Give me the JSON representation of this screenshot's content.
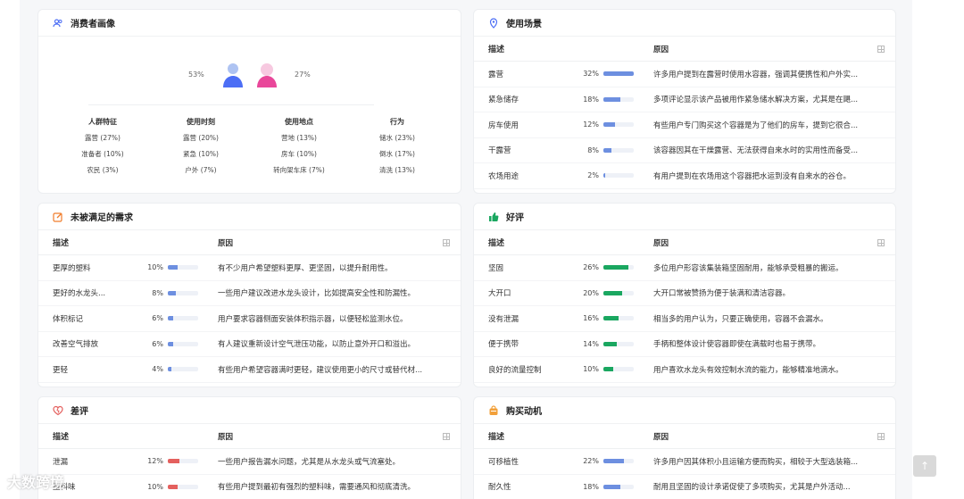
{
  "persona": {
    "title": "消费者画像",
    "male_pct": "53%",
    "female_pct": "27%",
    "columns": [
      {
        "header": "人群特征",
        "values": [
          "露营 (27%)",
          "准备者 (10%)",
          "农民 (3%)"
        ]
      },
      {
        "header": "使用时刻",
        "values": [
          "露营 (20%)",
          "紧急 (10%)",
          "户外 (7%)"
        ]
      },
      {
        "header": "使用地点",
        "values": [
          "营地 (13%)",
          "房车 (10%)",
          "转向架车床 (7%)"
        ]
      },
      {
        "header": "行为",
        "values": [
          "储水 (23%)",
          "倒水 (17%)",
          "清洗 (13%)"
        ]
      }
    ]
  },
  "usage": {
    "title": "使用场景",
    "col_desc": "描述",
    "col_reason": "原因",
    "rows": [
      {
        "desc": "露营",
        "pct": "32%",
        "value": 32,
        "reason": "许多用户提到在露营时使用水容器，强调其便携性和户外实..."
      },
      {
        "desc": "紧急储存",
        "pct": "18%",
        "value": 18,
        "reason": "多项评论显示该产品被用作紧急储水解决方案，尤其是在飓..."
      },
      {
        "desc": "房车使用",
        "pct": "12%",
        "value": 12,
        "reason": "有些用户专门购买这个容器是为了他们的房车，提到它很合..."
      },
      {
        "desc": "干露营",
        "pct": "8%",
        "value": 8,
        "reason": "该容器因其在干燥露营、无法获得自来水时的实用性而备受..."
      },
      {
        "desc": "农场用途",
        "pct": "2%",
        "value": 2,
        "reason": "有用户提到在农场用这个容器把水运到没有自来水的谷仓。"
      }
    ]
  },
  "unmet": {
    "title": "未被满足的需求",
    "col_desc": "描述",
    "col_reason": "原因",
    "rows": [
      {
        "desc": "更厚的塑料",
        "pct": "10%",
        "value": 10,
        "reason": "有不少用户希望塑料更厚、更坚固，以提升耐用性。"
      },
      {
        "desc": "更好的水龙头...",
        "pct": "8%",
        "value": 8,
        "reason": "一些用户建议改进水龙头设计，比如提高安全性和防漏性。"
      },
      {
        "desc": "体积标记",
        "pct": "6%",
        "value": 6,
        "reason": "用户要求容器侧面安装体积指示器，以便轻松监测水位。"
      },
      {
        "desc": "改善空气排放",
        "pct": "6%",
        "value": 6,
        "reason": "有人建议重新设计空气泄压功能，以防止意外开口和溢出。"
      },
      {
        "desc": "更轻",
        "pct": "4%",
        "value": 4,
        "reason": "有些用户希望容器满时更轻，建议使用更小的尺寸或替代材..."
      }
    ]
  },
  "positive": {
    "title": "好评",
    "col_desc": "描述",
    "col_reason": "原因",
    "rows": [
      {
        "desc": "坚固",
        "pct": "26%",
        "value": 26,
        "reason": "多位用户形容该集装箱坚固耐用，能够承受粗暴的搬运。"
      },
      {
        "desc": "大开口",
        "pct": "20%",
        "value": 20,
        "reason": "大开口常被赞扬为便于装满和清洁容器。"
      },
      {
        "desc": "没有泄漏",
        "pct": "16%",
        "value": 16,
        "reason": "相当多的用户认为，只要正确使用，容器不会漏水。"
      },
      {
        "desc": "便于携带",
        "pct": "14%",
        "value": 14,
        "reason": "手柄和整体设计使容器即使在满载时也易于携带。"
      },
      {
        "desc": "良好的流量控制",
        "pct": "10%",
        "value": 10,
        "reason": "用户喜欢水龙头有效控制水流的能力，能够精准地滴水。"
      }
    ]
  },
  "negative": {
    "title": "差评",
    "col_desc": "描述",
    "col_reason": "原因",
    "rows": [
      {
        "desc": "泄漏",
        "pct": "12%",
        "value": 12,
        "reason": "一些用户报告漏水问题，尤其是从水龙头或气流塞处。"
      },
      {
        "desc": "塑料味",
        "pct": "10%",
        "value": 10,
        "reason": "有些用户提到最初有强烈的塑料味，需要通风和彻底清洗。"
      }
    ]
  },
  "motive": {
    "title": "购买动机",
    "col_desc": "描述",
    "col_reason": "原因",
    "rows": [
      {
        "desc": "可移植性",
        "pct": "22%",
        "value": 22,
        "reason": "许多用户因其体积小且运输方便而购买，相较于大型选装箱..."
      },
      {
        "desc": "耐久性",
        "pct": "18%",
        "value": 18,
        "reason": "耐用且坚固的设计承诺促使了多项购买，尤其是户外活动..."
      }
    ]
  },
  "colors": {
    "blue": "#6d8fe0",
    "green": "#1aa760",
    "red": "#e4605e",
    "orange": "#f07c2a",
    "icon_blue": "#4c6ef5"
  },
  "watermark": "大数跨境",
  "scroll_top_label": "↑"
}
